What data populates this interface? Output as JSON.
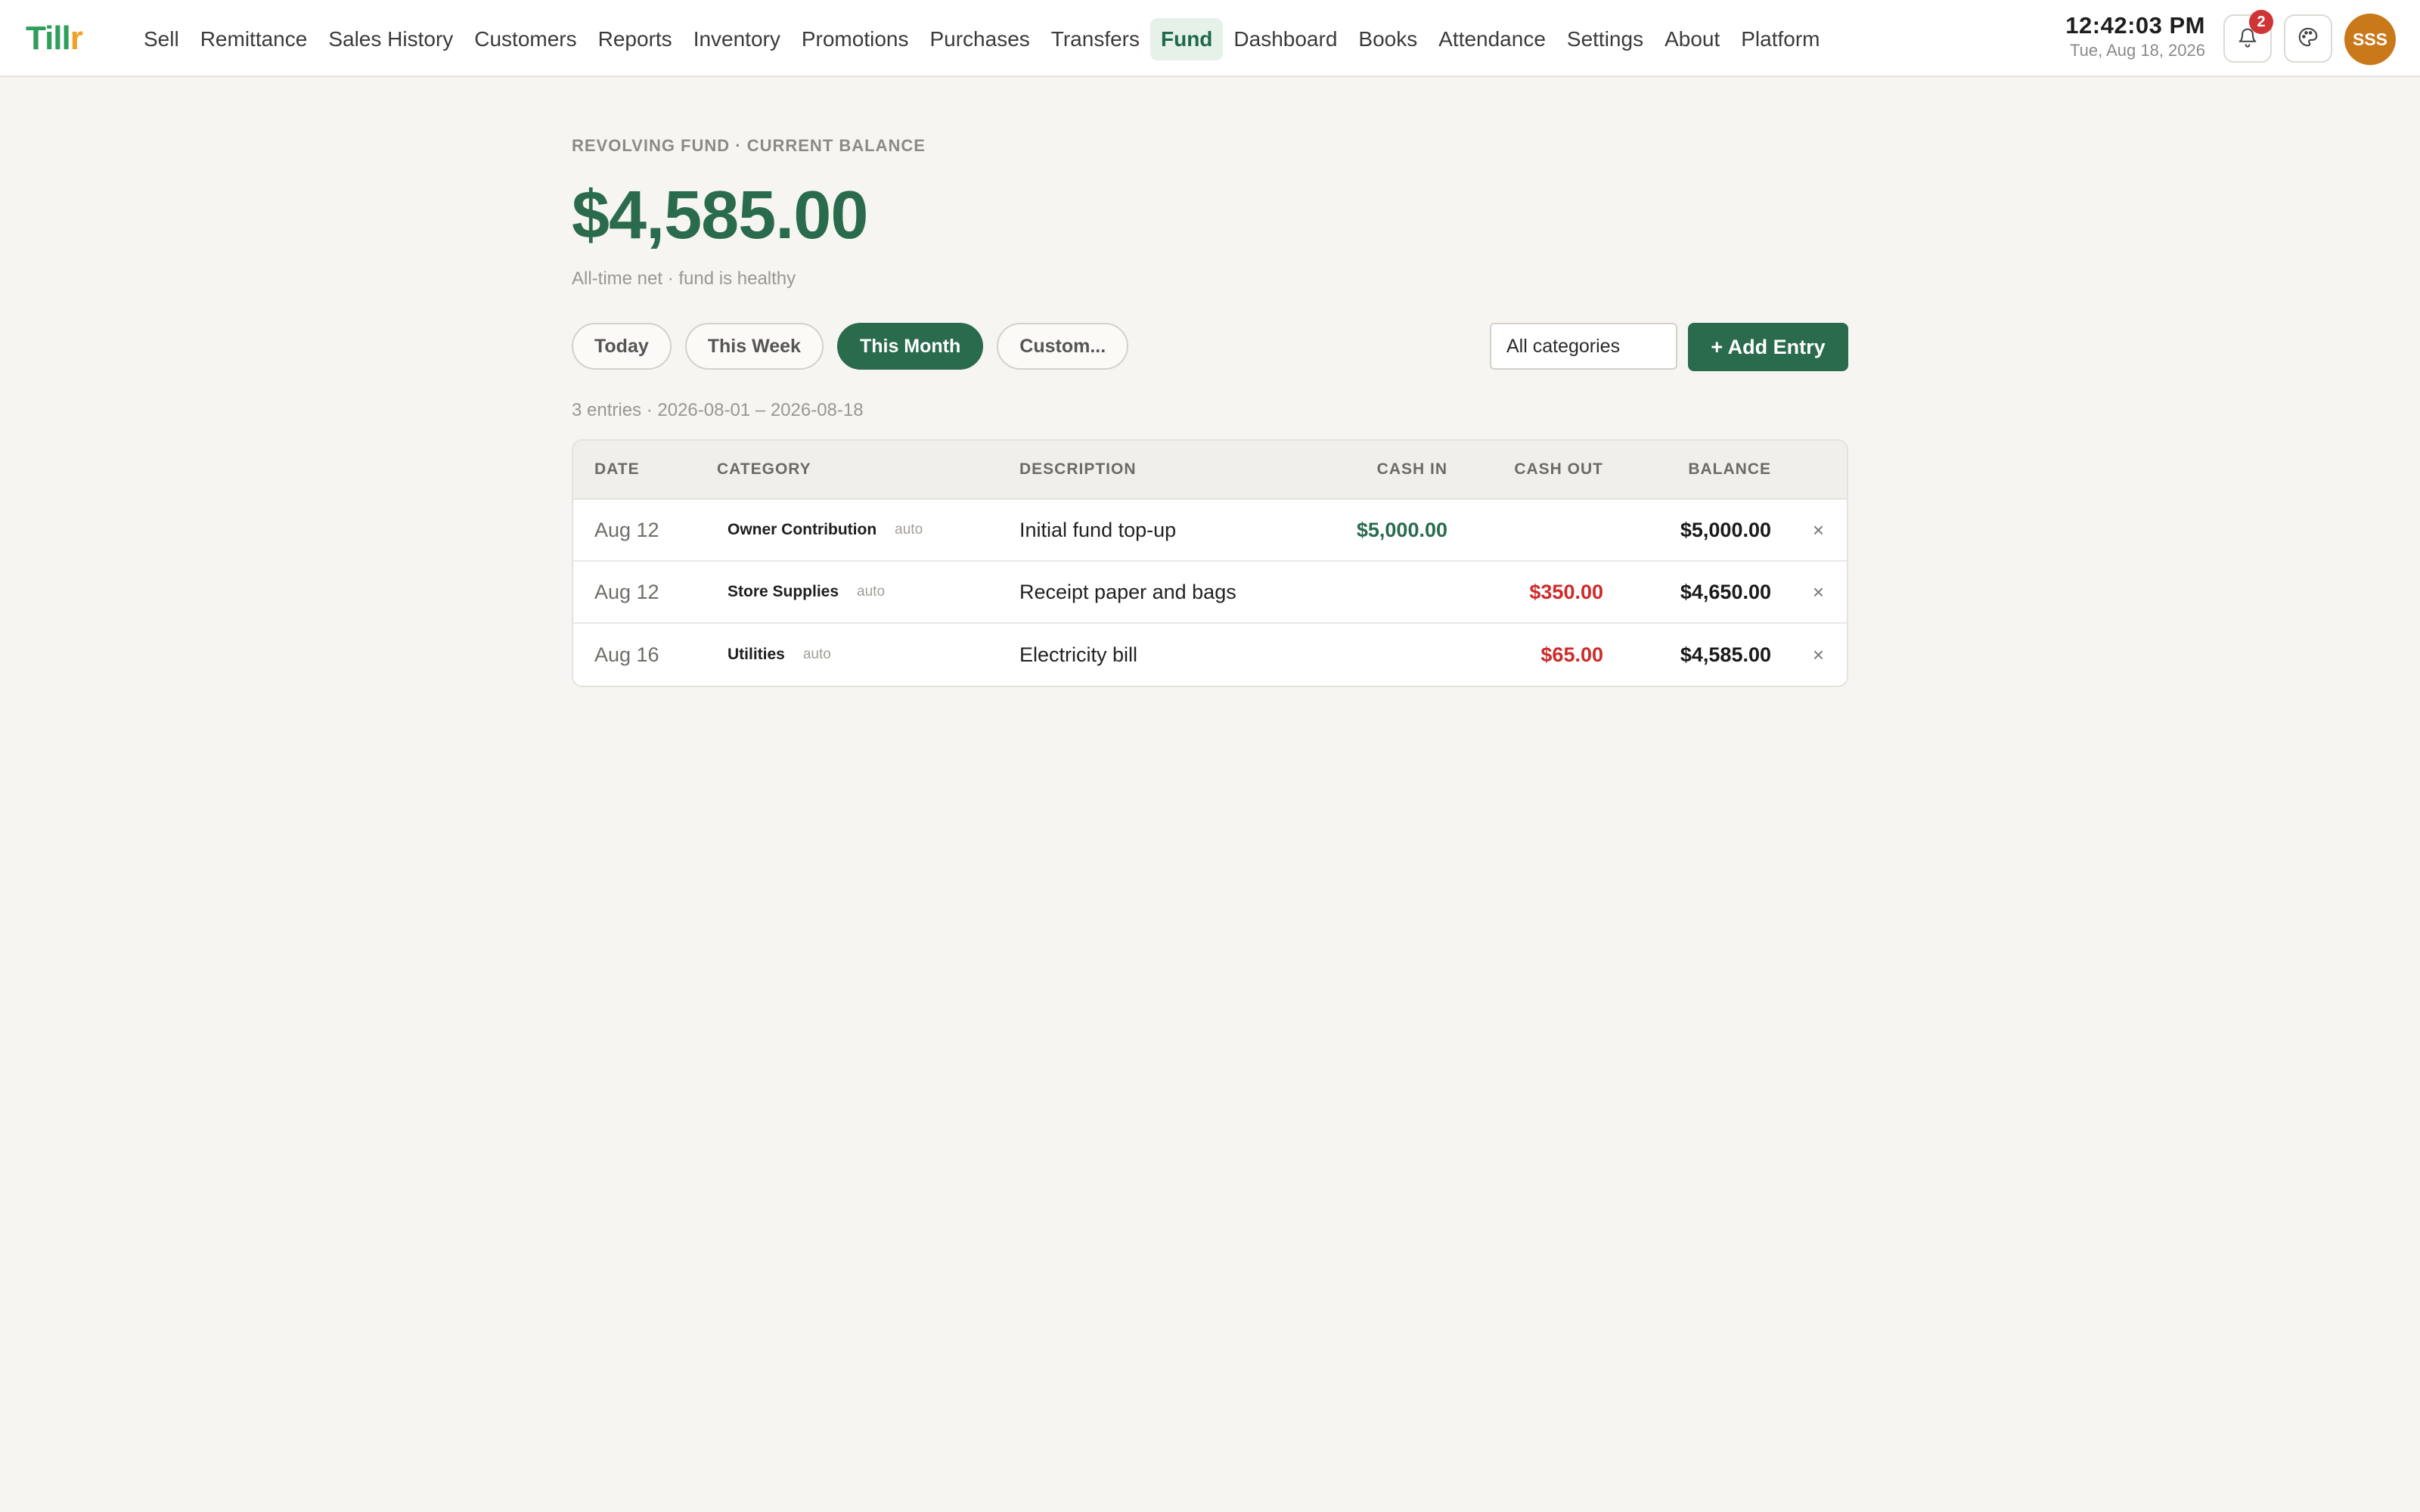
{
  "brand": {
    "logo_main": "Till",
    "logo_accent": "r"
  },
  "nav": {
    "items": [
      {
        "label": "Sell"
      },
      {
        "label": "Remittance"
      },
      {
        "label": "Sales History"
      },
      {
        "label": "Customers"
      },
      {
        "label": "Reports"
      },
      {
        "label": "Inventory"
      },
      {
        "label": "Promotions"
      },
      {
        "label": "Purchases"
      },
      {
        "label": "Transfers"
      },
      {
        "label": "Fund",
        "active": true
      },
      {
        "label": "Dashboard"
      },
      {
        "label": "Books"
      },
      {
        "label": "Attendance"
      },
      {
        "label": "Settings"
      },
      {
        "label": "About"
      },
      {
        "label": "Platform"
      }
    ]
  },
  "header": {
    "time": "12:42:03 PM",
    "date": "Tue, Aug 18, 2026",
    "notification_count": "2",
    "bell_icon": "bell-icon",
    "palette_icon": "palette-icon",
    "avatar_initials": "SSS"
  },
  "fund": {
    "eyebrow": "Revolving Fund · Current Balance",
    "balance": "$4,585.00",
    "subline": "All-time net · fund is healthy"
  },
  "filters": {
    "ranges": [
      {
        "label": "Today"
      },
      {
        "label": "This Week"
      },
      {
        "label": "This Month",
        "active": true
      },
      {
        "label": "Custom..."
      }
    ],
    "category_select": "All categories",
    "add_button": "+ Add Entry"
  },
  "summary": "3 entries · 2026-08-01 – 2026-08-18",
  "table": {
    "headers": {
      "date": "Date",
      "category": "Category",
      "description": "Description",
      "cash_in": "Cash In",
      "cash_out": "Cash Out",
      "balance": "Balance"
    },
    "rows": [
      {
        "date": "Aug 12",
        "category": "Owner Contribution",
        "tag": "auto",
        "description": "Initial fund top-up",
        "cash_in": "$5,000.00",
        "cash_out": "",
        "balance": "$5,000.00",
        "delete": "×"
      },
      {
        "date": "Aug 12",
        "category": "Store Supplies",
        "tag": "auto",
        "description": "Receipt paper and bags",
        "cash_in": "",
        "cash_out": "$350.00",
        "balance": "$4,650.00",
        "delete": "×"
      },
      {
        "date": "Aug 16",
        "category": "Utilities",
        "tag": "auto",
        "description": "Electricity bill",
        "cash_in": "",
        "cash_out": "$65.00",
        "balance": "$4,585.00",
        "delete": "×"
      }
    ]
  },
  "colors": {
    "accent": "#2a6b4d",
    "cash_in": "#2a6b4d",
    "cash_out": "#cf2a2a",
    "badge": "#d03535",
    "avatar": "#c9781a"
  }
}
